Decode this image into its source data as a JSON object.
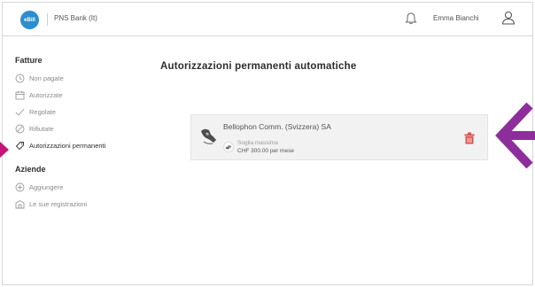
{
  "header": {
    "logo_text": "eBill",
    "bank_name": "PNS Bank (It)",
    "user_name": "Emma Bianchi"
  },
  "sidebar": {
    "section1_title": "Fatture",
    "items": [
      {
        "label": "Non pagate",
        "icon": "clock-icon"
      },
      {
        "label": "Autorizzate",
        "icon": "calendar-icon"
      },
      {
        "label": "Regolate",
        "icon": "check-icon"
      },
      {
        "label": "Rifiutate",
        "icon": "blocked-icon"
      },
      {
        "label": "Autorizzazioni permanenti",
        "icon": "tag-icon",
        "active": true
      }
    ],
    "section2_title": "Aziende",
    "items2": [
      {
        "label": "Aggiungere",
        "icon": "plus-circle-icon"
      },
      {
        "label": "Le sue registrazioni",
        "icon": "building-icon"
      }
    ]
  },
  "main": {
    "title": "Autorizzazioni permanenti automatiche",
    "card": {
      "payee": "Bellophon Comm. (Svizzera) SA",
      "limit_label": "Soglia massima",
      "limit_value": "CHF 300.00 per mese"
    }
  },
  "colors": {
    "logo_blue": "#2a8ecf",
    "annotation_purple": "#8e2d9c",
    "pointer_magenta": "#c4147a",
    "delete_red": "#d9534f"
  }
}
